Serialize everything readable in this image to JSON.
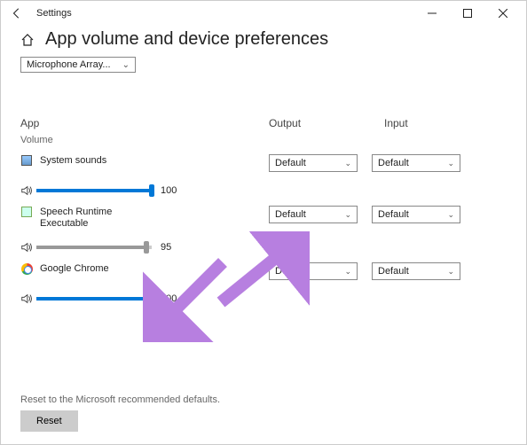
{
  "window": {
    "title": "Settings"
  },
  "page": {
    "title": "App volume and device preferences"
  },
  "topDropdown": {
    "label": "Microphone Array..."
  },
  "columns": {
    "app": "App",
    "volume": "Volume",
    "output": "Output",
    "input": "Input"
  },
  "apps": [
    {
      "name": "System sounds",
      "name2": "",
      "volume": 100,
      "volLabel": "100",
      "output": "Default",
      "input": "Default",
      "iconType": "sys",
      "active": true
    },
    {
      "name": "Speech Runtime",
      "name2": "Executable",
      "volume": 95,
      "volLabel": "95",
      "output": "Default",
      "input": "Default",
      "iconType": "speech",
      "active": false
    },
    {
      "name": "Google Chrome",
      "name2": "",
      "volume": 100,
      "volLabel": "100",
      "output": "Default",
      "input": "Default",
      "iconType": "chrome",
      "active": true
    }
  ],
  "reset": {
    "text": "Reset to the Microsoft recommended defaults.",
    "button": "Reset"
  }
}
